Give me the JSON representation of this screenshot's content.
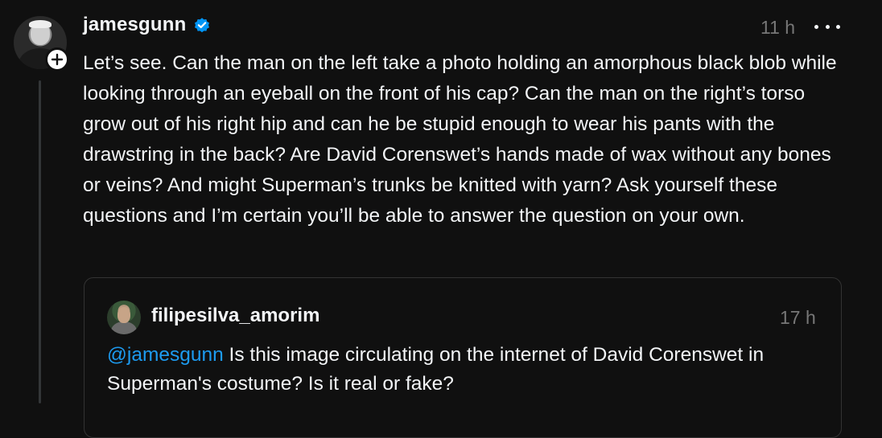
{
  "post": {
    "username": "jamesgunn",
    "time": "11 h",
    "text": "Let’s see. Can the man on the left take a photo holding an amorphous black blob while looking through an eyeball on the front of his cap? Can the man on the right’s torso grow out of his right hip and can he be stupid enough to wear his pants with the drawstring in the back? Are David Corenswet’s hands made of wax without any bones or veins? And might Superman’s trunks be knitted with yarn? Ask yourself these questions and I’m certain you’ll be able to answer the question on your own.",
    "verified_icon": "verified-badge-icon",
    "more_icon": "more-horizontal-icon",
    "follow_icon": "plus-icon"
  },
  "quoted_post": {
    "username": "filipesilva_amorim",
    "time": "17 h",
    "mention": "@jamesgunn",
    "text": " Is this image circulating on the internet of David Corenswet in Superman's costume? Is it real or fake?"
  },
  "colors": {
    "background": "#101010",
    "text": "#f3f5f7",
    "muted": "#777777",
    "link": "#1d9bf0",
    "verified": "#0095f6"
  }
}
